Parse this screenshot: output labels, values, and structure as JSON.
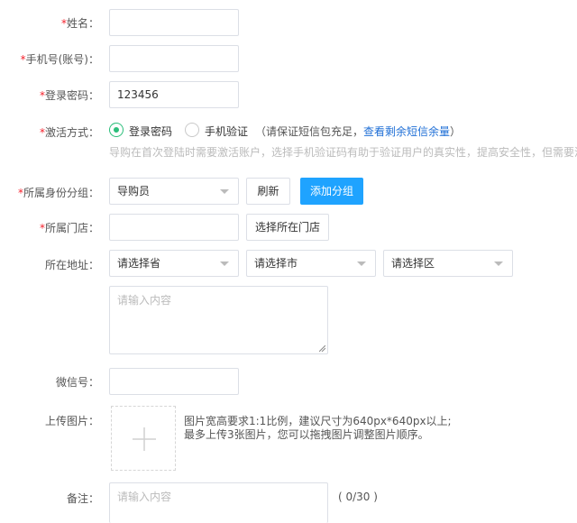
{
  "form": {
    "name": {
      "required_mark": "*",
      "label": "姓名：",
      "value": ""
    },
    "phone": {
      "required_mark": "*",
      "label": "手机号(账号)：",
      "value": ""
    },
    "password": {
      "required_mark": "*",
      "label": "登录密码：",
      "value": "123456"
    },
    "activation": {
      "required_mark": "*",
      "label": "激活方式：",
      "options": [
        {
          "label": "登录密码",
          "selected": true
        },
        {
          "label": "手机验证",
          "selected": false
        }
      ],
      "note_prefix": "（请保证短信包充足，",
      "note_link": "查看剩余短信余量",
      "note_suffix": "）",
      "hint": "导购在首次登陆时需要激活账户，选择手机验证码有助于验证用户的真实性，提高安全性，但需要消耗短信包"
    },
    "group": {
      "required_mark": "*",
      "label": "所属身份分组：",
      "selected": "导购员",
      "refresh_label": "刷新",
      "add_label": "添加分组"
    },
    "store": {
      "required_mark": "*",
      "label": "所属门店：",
      "value": "",
      "choose_label": "选择所在门店"
    },
    "address": {
      "label": "所在地址：",
      "province_placeholder": "请选择省",
      "city_placeholder": "请选择市",
      "district_placeholder": "请选择区",
      "detail_placeholder": "请输入内容"
    },
    "wechat": {
      "label": "微信号：",
      "value": ""
    },
    "upload": {
      "label": "上传图片：",
      "plus": "+",
      "hint_line1": "图片宽高要求1:1比例，建议尺寸为640px*640px以上;",
      "hint_line2": "最多上传3张图片，您可以拖拽图片调整图片顺序。"
    },
    "remark": {
      "label": "备注：",
      "placeholder": "请输入内容",
      "counter": "( 0/30 )"
    }
  },
  "colors": {
    "required": "#f5222d",
    "primary": "#1fa3ff",
    "radio_active": "#2bbe7a",
    "link": "#1f6fd6"
  }
}
